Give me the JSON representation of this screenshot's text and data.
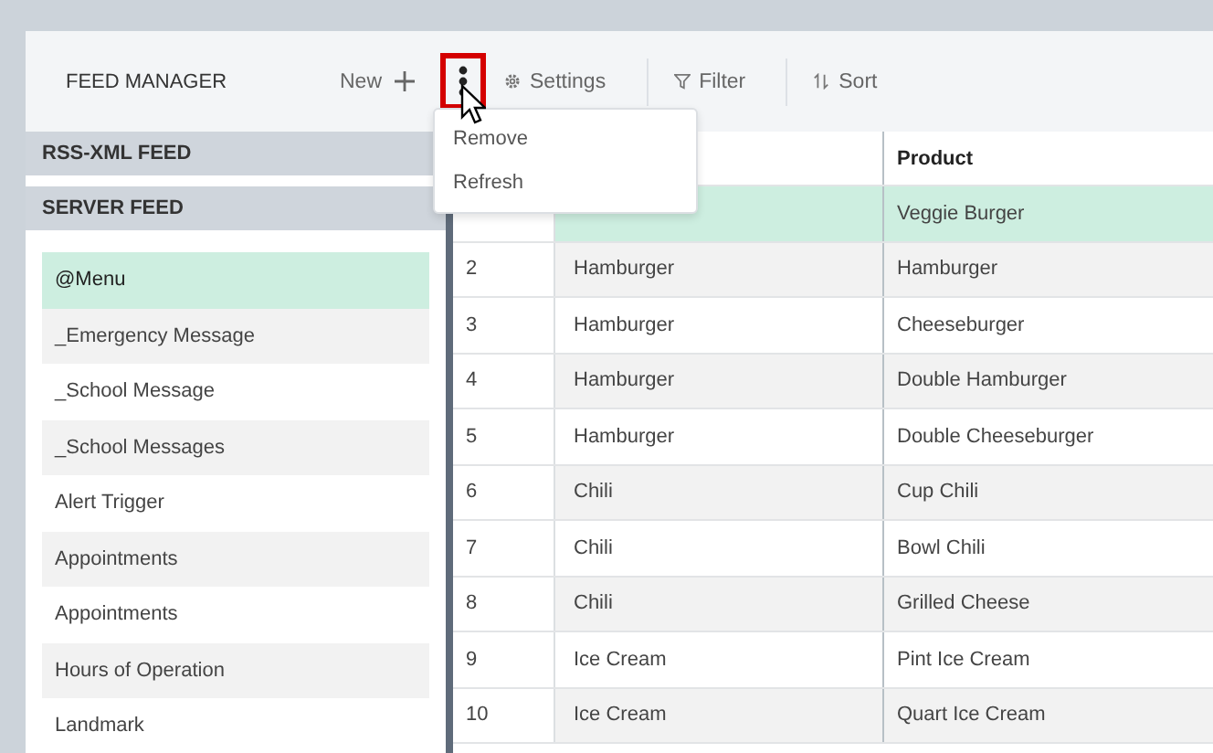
{
  "header": {
    "title": "FEED MANAGER",
    "toolbar": [
      {
        "kind": "new",
        "label": "New"
      },
      {
        "kind": "more",
        "highlighted": true
      },
      {
        "kind": "settings",
        "label": "Settings"
      },
      {
        "kind": "filter",
        "label": "Filter"
      },
      {
        "kind": "sort",
        "label": "Sort"
      }
    ]
  },
  "menu": {
    "items": [
      "Remove",
      "Refresh"
    ]
  },
  "sidebar": {
    "sections": [
      "RSS-XML FEED",
      "SERVER FEED"
    ],
    "items": [
      {
        "label": "@Menu",
        "selected": true
      },
      {
        "label": "_Emergency Message",
        "selected": false
      },
      {
        "label": "_School Message",
        "selected": false
      },
      {
        "label": "_School Messages",
        "selected": false
      },
      {
        "label": "Alert Trigger",
        "selected": false
      },
      {
        "label": "Appointments",
        "selected": false
      },
      {
        "label": "Appointments",
        "selected": false
      },
      {
        "label": "Hours of Operation",
        "selected": false
      },
      {
        "label": "Landmark",
        "selected": false
      }
    ]
  },
  "table": {
    "column_3": "Product",
    "rows": [
      {
        "product": "Veggie Burger",
        "selected": true
      },
      {
        "number": "2",
        "category": "Hamburger",
        "product": "Hamburger",
        "selected": false
      },
      {
        "number": "3",
        "category": "Hamburger",
        "product": "Cheeseburger",
        "selected": false
      },
      {
        "number": "4",
        "category": "Hamburger",
        "product": "Double Hamburger",
        "selected": false
      },
      {
        "number": "5",
        "category": "Hamburger",
        "product": "Double Cheeseburger",
        "selected": false
      },
      {
        "number": "6",
        "category": "Chili",
        "product": "Cup Chili",
        "selected": false
      },
      {
        "number": "7",
        "category": "Chili",
        "product": "Bowl Chili",
        "selected": false
      },
      {
        "number": "8",
        "category": "Chili",
        "product": "Grilled Cheese",
        "selected": false
      },
      {
        "number": "9",
        "category": "Ice Cream",
        "product": "Pint Ice Cream",
        "selected": false
      },
      {
        "number": "10",
        "category": "Ice Cream",
        "product": "Quart Ice Cream",
        "selected": false
      }
    ]
  }
}
